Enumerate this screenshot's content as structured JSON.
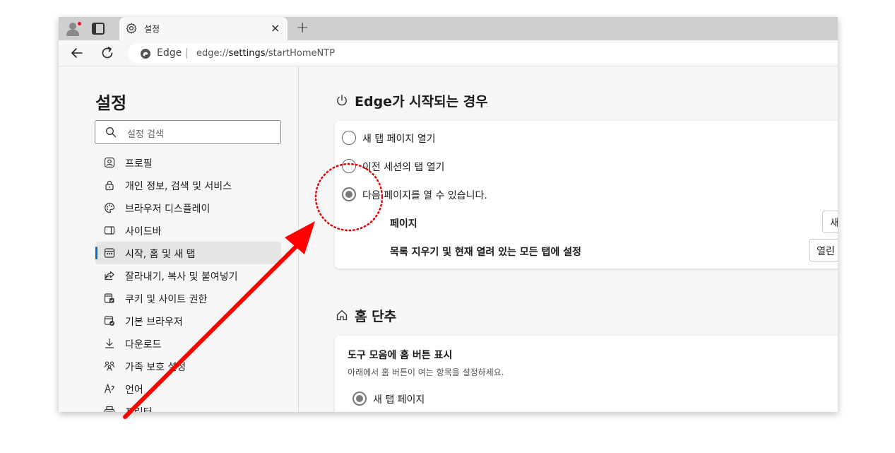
{
  "browser": {
    "tab_title": "설정",
    "tab_close": "×",
    "new_tab": "+",
    "omnibox_label": "Edge",
    "url_scheme": "edge://",
    "url_host": "settings",
    "url_path": "/startHomeNTP"
  },
  "sidebar": {
    "title": "설정",
    "search_placeholder": "설정 검색",
    "items": [
      {
        "label": "프로필",
        "icon": "profile-icon"
      },
      {
        "label": "개인 정보, 검색 및 서비스",
        "icon": "lock-icon"
      },
      {
        "label": "브라우저 디스플레이",
        "icon": "palette-icon"
      },
      {
        "label": "사이드바",
        "icon": "sidebar-icon"
      },
      {
        "label": "시작, 홈 및 새 탭",
        "icon": "start-home-icon",
        "active": true
      },
      {
        "label": "잘라내기, 복사 및 붙여넣기",
        "icon": "share-icon"
      },
      {
        "label": "쿠키 및 사이트 권한",
        "icon": "cookie-icon"
      },
      {
        "label": "기본 브라우저",
        "icon": "default-browser-icon"
      },
      {
        "label": "다운로드",
        "icon": "download-icon"
      },
      {
        "label": "가족 보호 설정",
        "icon": "family-icon"
      },
      {
        "label": "언어",
        "icon": "language-icon"
      },
      {
        "label": "프린터",
        "icon": "printer-icon"
      }
    ]
  },
  "startup": {
    "title": "Edge가 시작되는 경우",
    "options": [
      {
        "label": "새 탭 페이지 열기",
        "selected": false
      },
      {
        "label": "이전 세션의 탭 열기",
        "selected": false
      },
      {
        "label": "다음 페이지를 열 수 있습니다.",
        "selected": true
      }
    ],
    "pages_label": "페이지",
    "pages_button": "새",
    "clear_label": "목록 지우기 및 현재 열려 있는 모든 탭에 설정",
    "clear_button": "열린"
  },
  "home": {
    "title": "홈 단추",
    "show_label": "도구 모음에 홈 버튼 표시",
    "show_desc": "아래에서 홈 버튼이 여는 항목을 설정하세요.",
    "option_label": "새 탭 페이지",
    "option_selected": true
  },
  "annotation": {
    "arrow_color": "#ff0000",
    "circle_color": "#e00000"
  },
  "colors": {
    "accent": "#0f6cbd",
    "tabstrip": "#cfcfcf"
  }
}
